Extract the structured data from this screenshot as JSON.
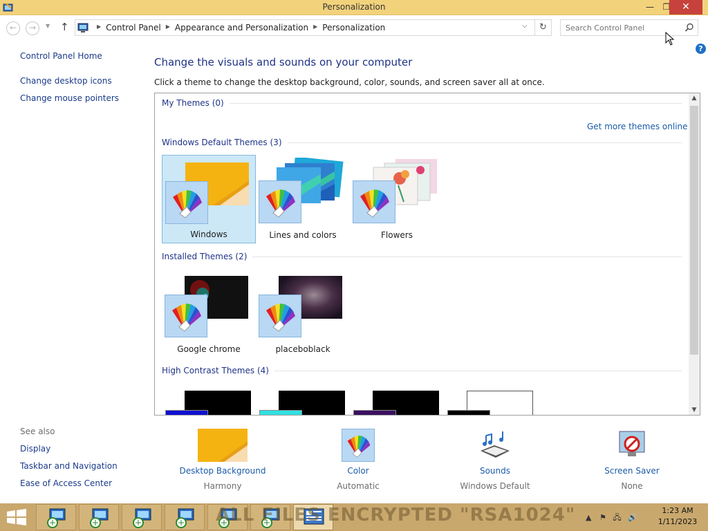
{
  "window": {
    "title": "Personalization"
  },
  "titlebar_buttons": {
    "minimize": "—",
    "restore": "❐",
    "close": "✕"
  },
  "nav": {
    "back": "←",
    "forward": "→",
    "dropdown": "▼",
    "up": "↑"
  },
  "address": {
    "crumbs": [
      "Control Panel",
      "Appearance and Personalization",
      "Personalization"
    ],
    "refresh": "↻",
    "dropdown": "⌵"
  },
  "search": {
    "placeholder": "Search Control Panel"
  },
  "help": "?",
  "left": {
    "home": "Control Panel Home",
    "links": [
      "Change desktop icons",
      "Change mouse pointers"
    ],
    "see_also_title": "See also",
    "see_also": [
      "Display",
      "Taskbar and Navigation",
      "Ease of Access Center"
    ]
  },
  "main": {
    "heading": "Change the visuals and sounds on your computer",
    "subtitle": "Click a theme to change the desktop background, color, sounds, and screen saver all at once.",
    "get_more": "Get more themes online",
    "sections": {
      "my": "My Themes (0)",
      "default": "Windows Default Themes (3)",
      "installed": "Installed Themes (2)",
      "high_contrast": "High Contrast Themes (4)"
    },
    "default_themes": [
      "Windows",
      "Lines and colors",
      "Flowers"
    ],
    "installed_themes": [
      "Google chrome",
      "placeboblack"
    ]
  },
  "bottom": [
    {
      "label": "Desktop Background",
      "value": "Harmony"
    },
    {
      "label": "Color",
      "value": "Automatic"
    },
    {
      "label": "Sounds",
      "value": "Windows Default"
    },
    {
      "label": "Screen Saver",
      "value": "None"
    }
  ],
  "taskbar": {
    "banner": "ALL FILES ENCRYPTED \"RSA1024\"",
    "time": "1:23 AM",
    "date": "1/11/2023"
  },
  "colors": {
    "accent": "#1e3287",
    "link": "#1a5aa8",
    "titlebar": "#f3d27c",
    "taskbar": "#c9a86e",
    "selected": "#cce8f7"
  }
}
